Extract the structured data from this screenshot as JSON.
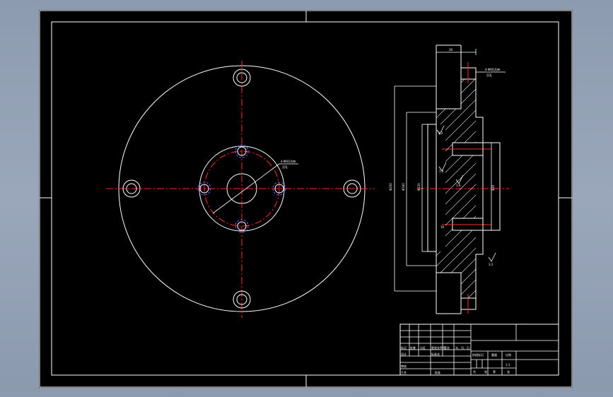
{
  "colors": {
    "background": "#8d9bb0",
    "sheet": "#000000",
    "outline": "#ffffff",
    "centerline": "#ff2a2a",
    "hidden_circle": "#6b63ff"
  },
  "front_view": {
    "leader_note": "4-Φ9孔均布",
    "leader_note_sub": "沉孔"
  },
  "section_view": {
    "top_dim": "30",
    "tl_note": "4-Φ9孔均布",
    "tl_note_sub": "沉孔",
    "dia_outer": "Φ200",
    "dia_mid": "Φ160",
    "dia_inner": "Φ120",
    "dia_bore": "Φ40",
    "rough_1": "3.2",
    "rough_2": "1.6",
    "rough_3": "1.6",
    "rough_4": "3.2",
    "dim_small": "10"
  },
  "title_block": {
    "row_labels": [
      "标记",
      "处数",
      "分区",
      "更改文件号",
      "签名",
      "年、月、日"
    ],
    "design": "设计",
    "standard": "标准化",
    "review": "审核",
    "process": "工艺",
    "approve": "批准",
    "stage": "阶段标记",
    "weight": "重量",
    "scale": "比例",
    "scale_value": "1:1",
    "sheets_total": "共",
    "sheets_unit": "张",
    "sheet_no": "第",
    "sheet_unit2": "张"
  }
}
